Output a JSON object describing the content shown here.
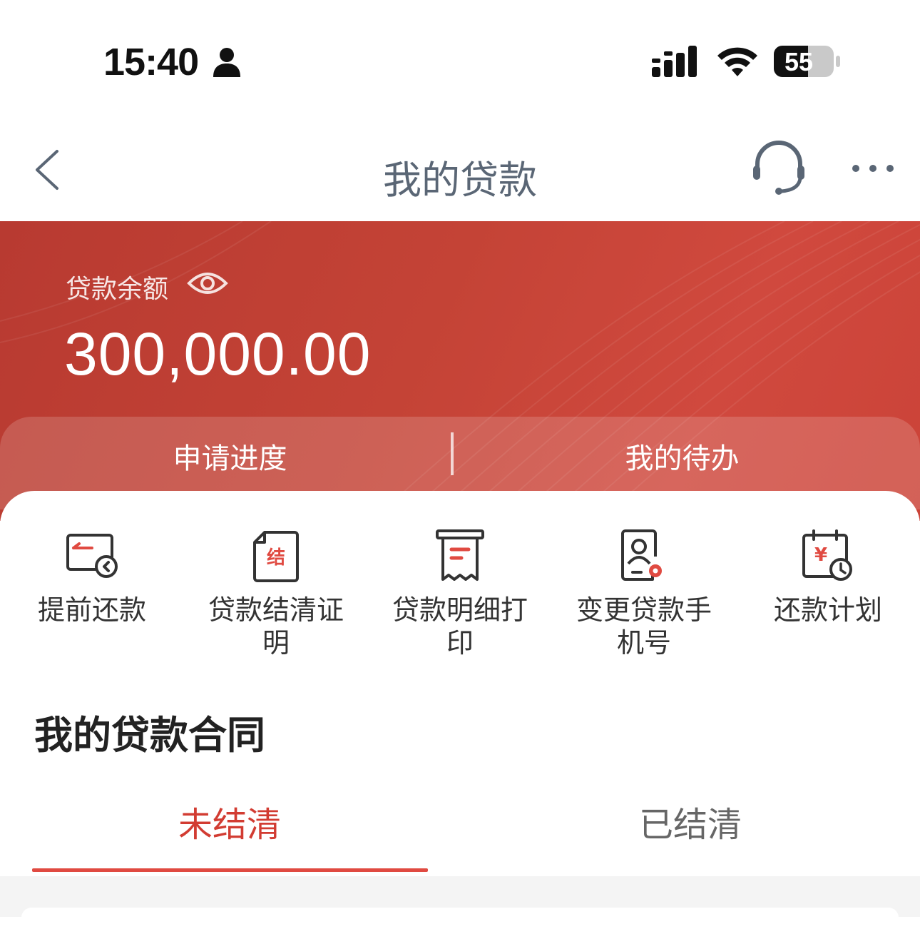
{
  "status_bar": {
    "time": "15:40",
    "battery": "55",
    "icons": [
      "person-icon",
      "signal-icon",
      "wifi-icon",
      "battery-icon"
    ]
  },
  "nav": {
    "title": "我的贷款",
    "icons": [
      "back-icon",
      "headset-icon",
      "more-icon"
    ]
  },
  "balance": {
    "label": "贷款余额",
    "amount": "300,000.00"
  },
  "quick_links": {
    "progress": "申请进度",
    "todo": "我的待办"
  },
  "functions": [
    {
      "label": "提前还款",
      "icon": "prepay-icon"
    },
    {
      "label": "贷款结清证明",
      "icon": "settlement-cert-icon"
    },
    {
      "label": "贷款明细打印",
      "icon": "receipt-print-icon"
    },
    {
      "label": "变更贷款手机号",
      "icon": "change-phone-icon"
    },
    {
      "label": "还款计划",
      "icon": "repay-plan-icon"
    }
  ],
  "contracts": {
    "title": "我的贷款合同",
    "tab_unsettled": "未结清",
    "tab_settled": "已结清"
  },
  "colors": {
    "brand_red": "#c8443a",
    "accent_red": "#d23c32",
    "title_gray": "#5a6675"
  }
}
